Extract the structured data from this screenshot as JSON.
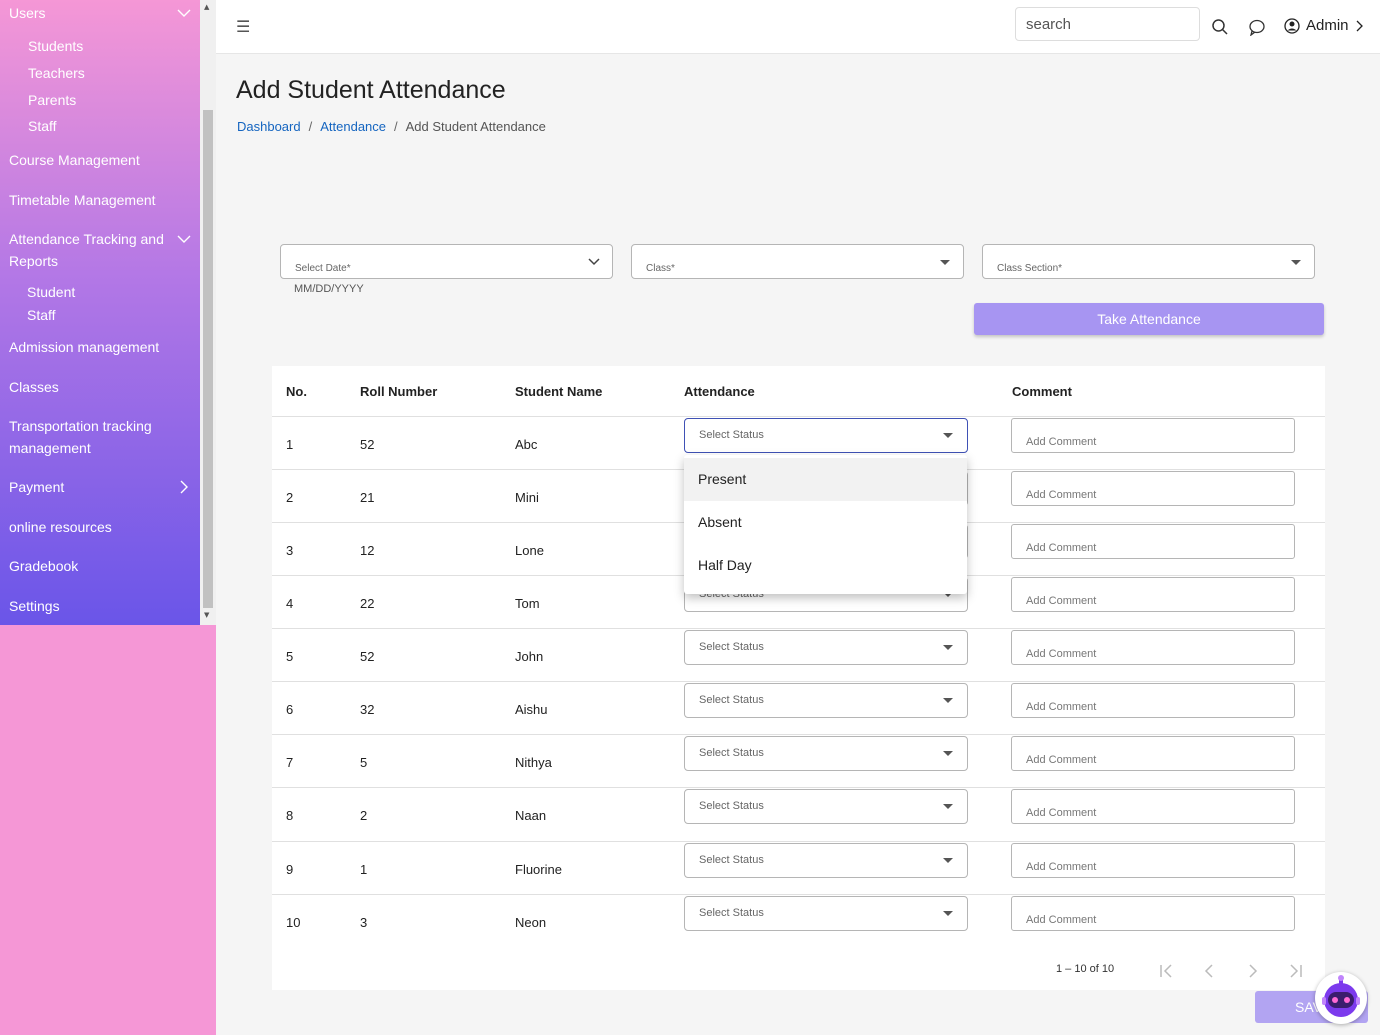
{
  "sidebar": {
    "items": [
      {
        "label": "Users"
      },
      {
        "label": "Course Management"
      },
      {
        "label": "Timetable Management"
      },
      {
        "label": "Attendance Tracking and Reports"
      },
      {
        "label": "Admission management"
      },
      {
        "label": "Classes"
      },
      {
        "label": "Transportation tracking management"
      },
      {
        "label": "Payment"
      },
      {
        "label": "online resources"
      },
      {
        "label": "Gradebook"
      },
      {
        "label": "Settings"
      }
    ],
    "users_sub": [
      "Students",
      "Teachers",
      "Parents",
      "Staff"
    ],
    "attendance_sub": [
      "Student",
      "Staff"
    ]
  },
  "header": {
    "search_placeholder": "search",
    "admin_label": "Admin"
  },
  "page": {
    "title": "Add Student Attendance",
    "breadcrumb": [
      "Dashboard",
      "Attendance",
      "Add Student Attendance"
    ]
  },
  "filters": {
    "date_label": "Select Date*",
    "date_hint": "MM/DD/YYYY",
    "class_label": "Class*",
    "section_label": "Class Section*",
    "take_attendance": "Take Attendance"
  },
  "table": {
    "columns": [
      "No.",
      "Roll Number",
      "Student Name",
      "Attendance",
      "Comment"
    ],
    "status_placeholder": "Select Status",
    "comment_placeholder": "Add Comment",
    "rows": [
      {
        "no": "1",
        "roll": "52",
        "name": "Abc"
      },
      {
        "no": "2",
        "roll": "21",
        "name": "Mini"
      },
      {
        "no": "3",
        "roll": "12",
        "name": "Lone"
      },
      {
        "no": "4",
        "roll": "22",
        "name": "Tom"
      },
      {
        "no": "5",
        "roll": "52",
        "name": "John"
      },
      {
        "no": "6",
        "roll": "32",
        "name": "Aishu"
      },
      {
        "no": "7",
        "roll": "5",
        "name": "Nithya"
      },
      {
        "no": "8",
        "roll": "2",
        "name": "Naan"
      },
      {
        "no": "9",
        "roll": "1",
        "name": "Fluorine"
      },
      {
        "no": "10",
        "roll": "3",
        "name": "Neon"
      }
    ]
  },
  "dropdown": {
    "options": [
      "Present",
      "Absent",
      "Half Day"
    ]
  },
  "pagination": {
    "range": "1 – 10 of 10"
  },
  "actions": {
    "save": "SAV"
  },
  "colors": {
    "accent": "#a795f2",
    "link": "#1565c0",
    "sidebar_top": "#f597d6",
    "sidebar_bottom": "#6a55e8"
  }
}
